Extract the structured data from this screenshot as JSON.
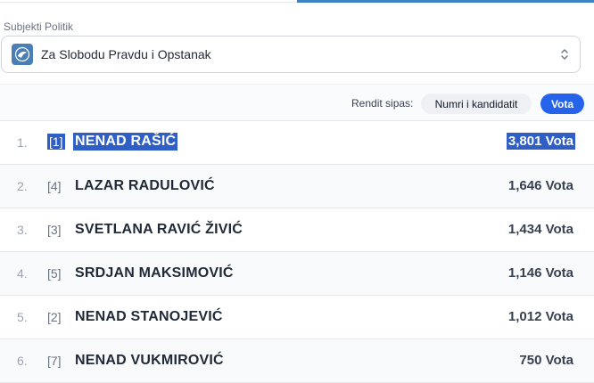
{
  "party_select": {
    "label": "Subjekti Politik",
    "selected": "Za Slobodu Pravdu i Opstanak"
  },
  "sort": {
    "label": "Rendit sipas:",
    "options": [
      "Numri i kandidatit",
      "Vota"
    ],
    "active": "Vota"
  },
  "candidates": [
    {
      "rank": "1.",
      "number": "[1]",
      "name": "NENAD RAŠIĆ",
      "votes": "3,801 Vota",
      "selected": true
    },
    {
      "rank": "2.",
      "number": "[4]",
      "name": "LAZAR RADULOVIĆ",
      "votes": "1,646 Vota"
    },
    {
      "rank": "3.",
      "number": "[3]",
      "name": "SVETLANA RAVIĆ ŽIVIĆ",
      "votes": "1,434 Vota"
    },
    {
      "rank": "4.",
      "number": "[5]",
      "name": "SRDJAN MAKSIMOVIĆ",
      "votes": "1,146 Vota"
    },
    {
      "rank": "5.",
      "number": "[2]",
      "name": "NENAD STANOJEVIĆ",
      "votes": "1,012 Vota"
    },
    {
      "rank": "6.",
      "number": "[7]",
      "name": "NENAD VUKMIROVIĆ",
      "votes": "750 Vota"
    }
  ],
  "colors": {
    "accent": "#2563eb",
    "selection": "#2f5fc4",
    "party_logo": "#4a7fb5"
  },
  "icons": {
    "party": "party-logo-icon",
    "select": "chevron-up-down-icon"
  }
}
